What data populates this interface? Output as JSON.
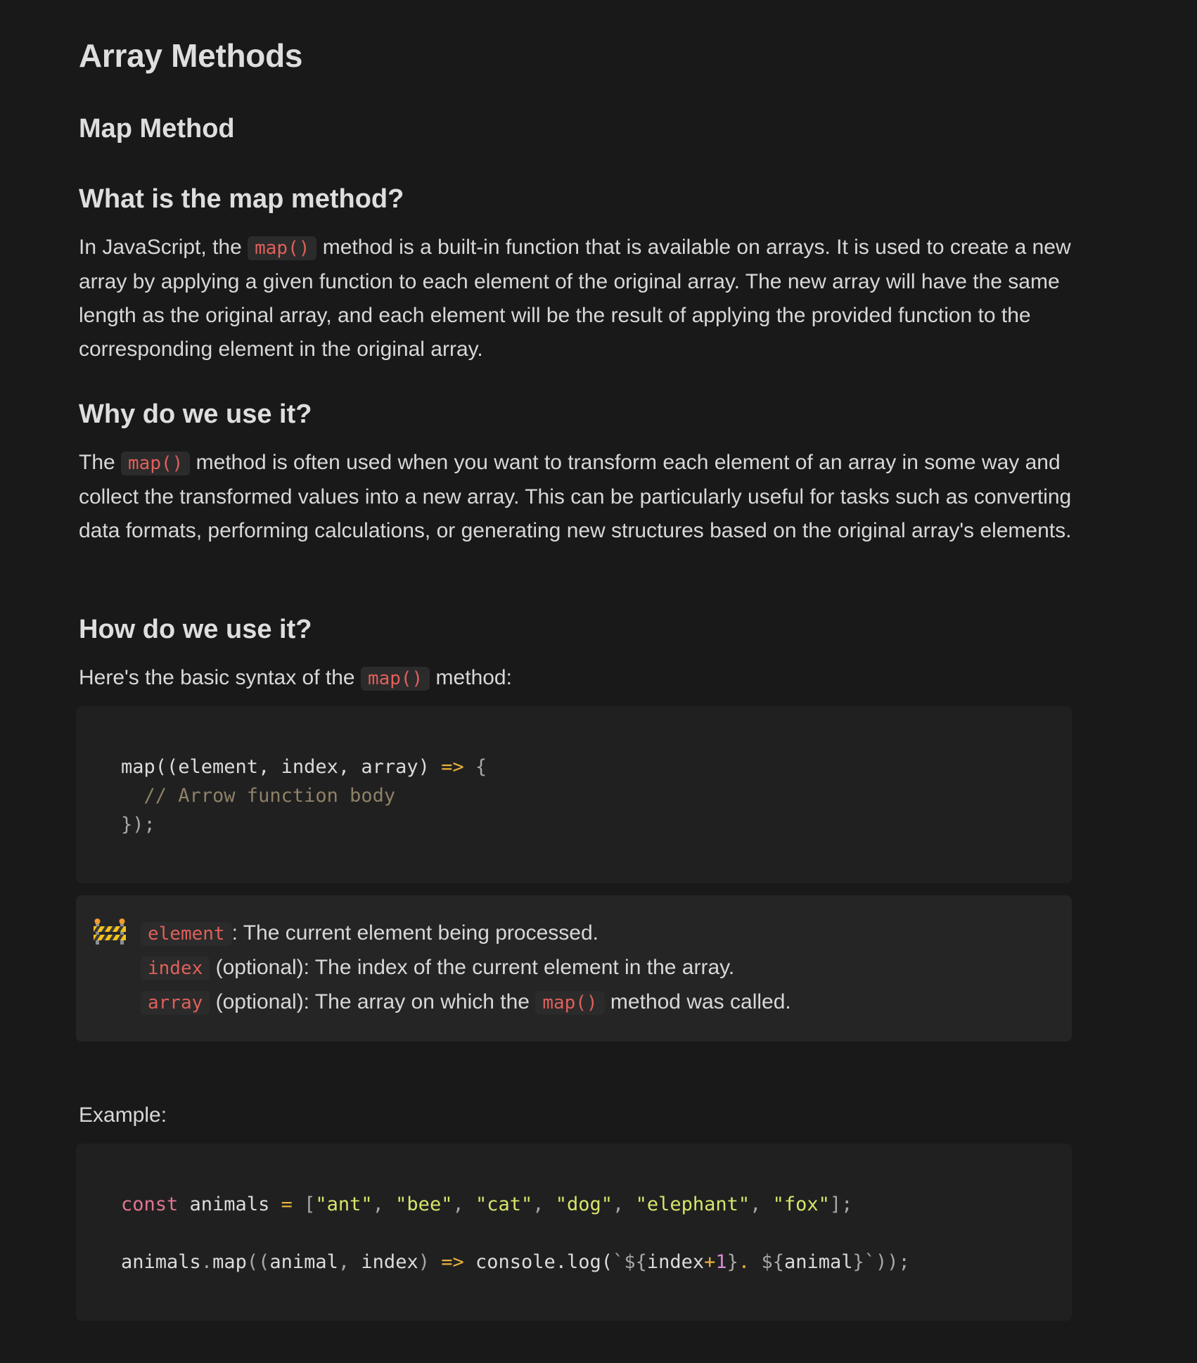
{
  "title": "Array Methods",
  "section": "Map Method",
  "what": {
    "heading": "What is the map method?",
    "before": "In JavaScript, the ",
    "code": "map()",
    "after": " method is a built-in function that is available on arrays. It is used to create a new array by applying a given function to each element of the original array. The new array will have the same length as the original array, and each element will be the result of applying the provided function to the corresponding element in the original array."
  },
  "why": {
    "heading": "Why do we use it?",
    "before": "The ",
    "code": "map()",
    "after": " method is often used when you want to transform each element of an array in some way and collect the transformed values into a new array. This can be particularly useful for tasks such as converting data formats, performing calculations, or generating new structures based on the original array's elements."
  },
  "how": {
    "heading": "How do we use it?",
    "before": "Here's the basic syntax of the ",
    "code": "map()",
    "after": " method:",
    "syntax": {
      "l1_a": "map((element, index, array) ",
      "l1_arrow": "=>",
      "l1_b": " {",
      "l2": "  // Arrow function body",
      "l3": "});"
    }
  },
  "callout": {
    "icon": "construction-icon",
    "items": [
      {
        "code": "element",
        "text": ": The current element being processed."
      },
      {
        "code": "index",
        "text": " (optional): The index of the current element in the array."
      },
      {
        "code": "array",
        "text": " (optional): The array on which the ",
        "code2": "map()",
        "text2": " method was called."
      }
    ]
  },
  "example": {
    "label": "Example:",
    "line1": {
      "kw": "const",
      "name": " animals ",
      "eq": "=",
      "open": " [",
      "s1": "\"ant\"",
      "s2": "\"bee\"",
      "s3": "\"cat\"",
      "s4": "\"dog\"",
      "s5": "\"elephant\"",
      "s6": "\"fox\"",
      "close": "];"
    },
    "line2": {
      "a": "animals",
      "dot": ".",
      "b": "map",
      "c": "((",
      "d": "animal",
      "e": ", ",
      "f": "index",
      "g": ") ",
      "arrow": "=>",
      "h": " console.log(",
      "tpl_open": "`${",
      "idx": "index",
      "plus": "+",
      "one": "1",
      "tpl_mid": "}",
      "dot2": ".",
      "tpl_mid2": " ${",
      "animal": "animal",
      "tpl_close": "}`",
      "end": "));"
    }
  },
  "colors": {
    "background": "#191919",
    "inline_code": "#e0605a",
    "keyword": "#e07690",
    "string": "#d8e46a",
    "operator": "#e8b23c",
    "comment": "#8e8167"
  }
}
